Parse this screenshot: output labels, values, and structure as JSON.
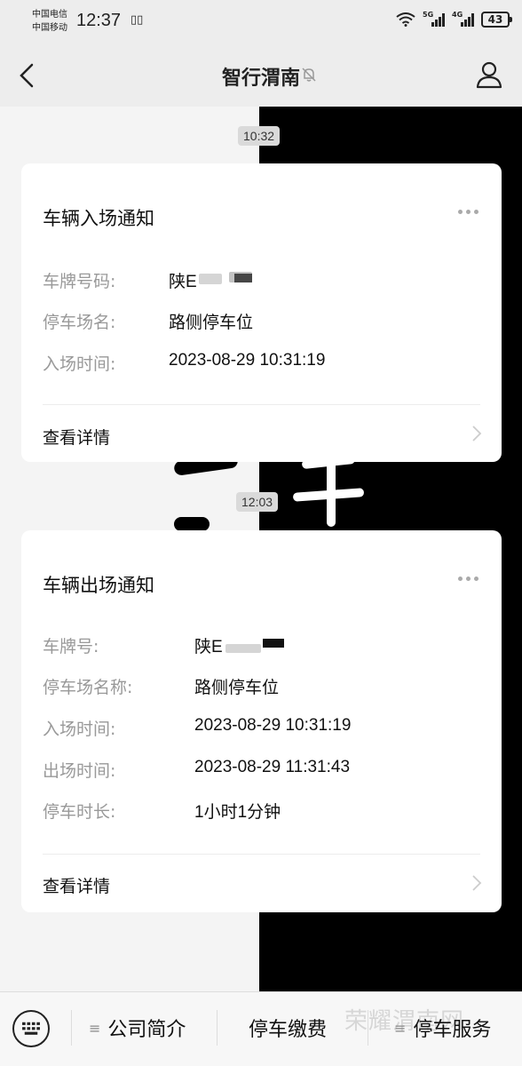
{
  "status": {
    "carrier1": "中国电信",
    "carrier2": "中国移动",
    "time": "12:37",
    "signal1_tag": "5G",
    "signal2_tag": "4G",
    "battery": "43"
  },
  "nav": {
    "title": "智行渭南",
    "back_icon": "chevron-left-icon",
    "mute_icon": "bell-off-icon",
    "profile_icon": "person-icon"
  },
  "messages": [
    {
      "timestamp": "10:32",
      "title": "车辆入场通知",
      "rows": [
        {
          "label": "车牌号码:",
          "value": "陕E"
        },
        {
          "label": "停车场名:",
          "value": "路侧停车位"
        },
        {
          "label": "入场时间:",
          "value": "2023-08-29 10:31:19"
        }
      ],
      "detail": "查看详情"
    },
    {
      "timestamp": "12:03",
      "title": "车辆出场通知",
      "rows": [
        {
          "label": "车牌号:",
          "value": "陕E"
        },
        {
          "label": "停车场名称:",
          "value": "路侧停车位"
        },
        {
          "label": "入场时间:",
          "value": "2023-08-29 10:31:19"
        },
        {
          "label": "出场时间:",
          "value": "2023-08-29 11:31:43"
        },
        {
          "label": "停车时长:",
          "value": "1小时1分钟"
        }
      ],
      "detail": "查看详情"
    }
  ],
  "bottom": {
    "keyboard_icon": "keyboard-icon",
    "menu": [
      "公司简介",
      "停车缴费",
      "停车服务"
    ],
    "watermark": "荣耀渭南网"
  },
  "colors": {
    "background": "#ededed",
    "card": "#ffffff",
    "label": "#999999"
  }
}
